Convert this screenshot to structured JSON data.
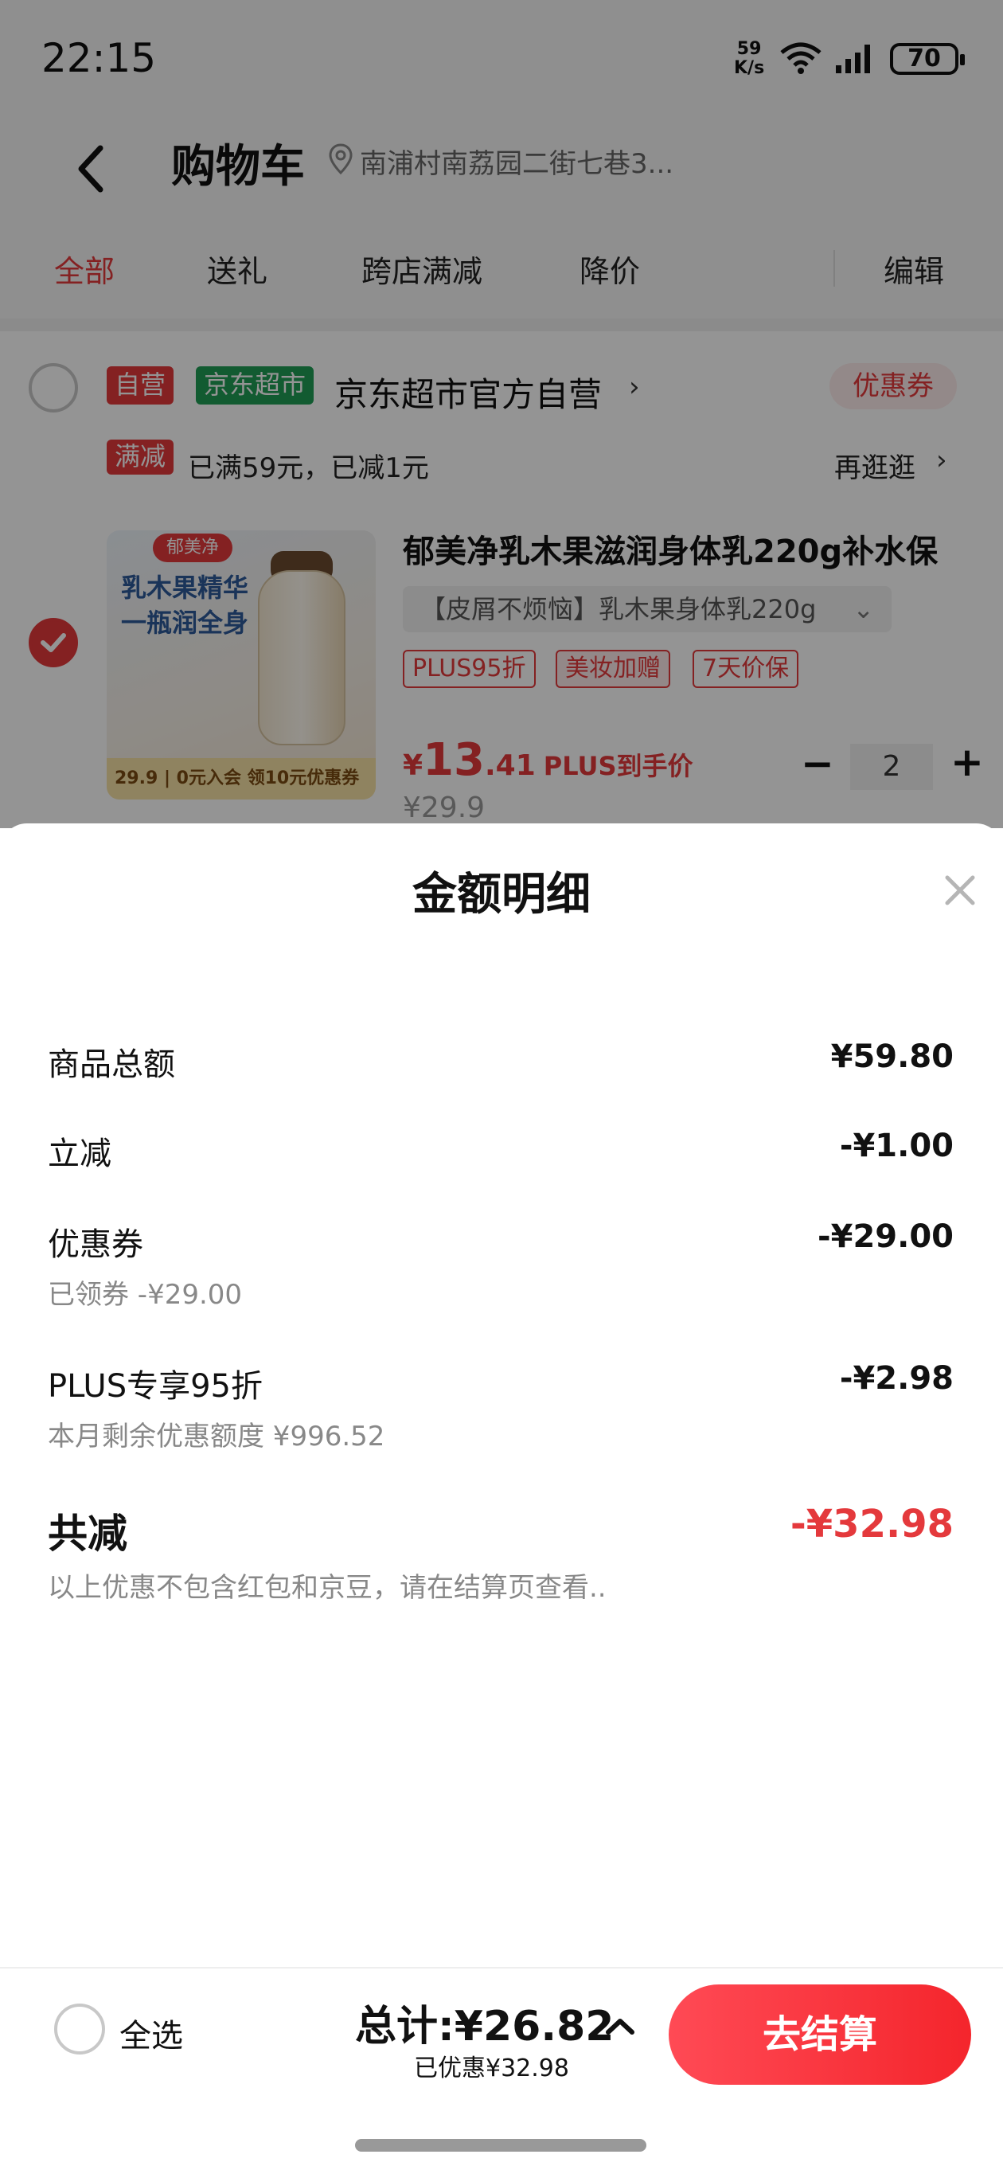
{
  "status_bar": {
    "time": "22:15",
    "net_speed_value": "59",
    "net_speed_unit": "K/s",
    "battery": "70"
  },
  "header": {
    "title": "购物车",
    "address": "南浦村南荔园二街七巷3..."
  },
  "tabs": [
    {
      "label": "全部",
      "active": true
    },
    {
      "label": "送礼"
    },
    {
      "label": "跨店满减"
    },
    {
      "label": "降价"
    }
  ],
  "edit_label": "编辑",
  "store": {
    "tag_self": "自营",
    "tag_market": "京东超市",
    "name": "京东超市官方自营",
    "coupon_label": "优惠券",
    "promo_tag": "满减",
    "promo_text": "已满59元，已减1元",
    "promo_more": "再逛逛"
  },
  "product": {
    "img_brand": "郁美净",
    "img_text_1": "乳木果精华",
    "img_text_2": "一瓶润全身",
    "img_strip": "29.9 | 0元入会 领10元优惠券",
    "title": "郁美净乳木果滋润身体乳220g补水保",
    "variant": "【皮屑不烦恼】乳木果身体乳220g",
    "tags": [
      "PLUS95折",
      "美妆加赠",
      "7天价保"
    ],
    "price_currency": "¥",
    "price_int": "13",
    "price_dec": ".41",
    "price_label": "PLUS到手价",
    "original_price": "¥29.9",
    "quantity": "2"
  },
  "sheet": {
    "title": "金额明细",
    "rows": [
      {
        "label": "商品总额",
        "value": "¥59.80"
      },
      {
        "label": "立减",
        "value": "-¥1.00"
      },
      {
        "label": "优惠券",
        "value": "-¥29.00",
        "sub": "已领券 -¥29.00"
      },
      {
        "label": "PLUS专享95折",
        "value": "-¥2.98",
        "sub": "本月剩余优惠额度 ¥996.52"
      }
    ],
    "total_label": "共减",
    "total_value": "-¥32.98",
    "total_note": "以上优惠不包含红包和京豆，请在结算页查看.."
  },
  "bottom_bar": {
    "select_all": "全选",
    "total": "总计:¥26.82",
    "discount": "已优惠¥32.98",
    "checkout": "去结算"
  },
  "colors": {
    "accent": "#e4393c",
    "market_green": "#1f9d55",
    "overlay": "rgba(0,0,0,0.42)"
  }
}
